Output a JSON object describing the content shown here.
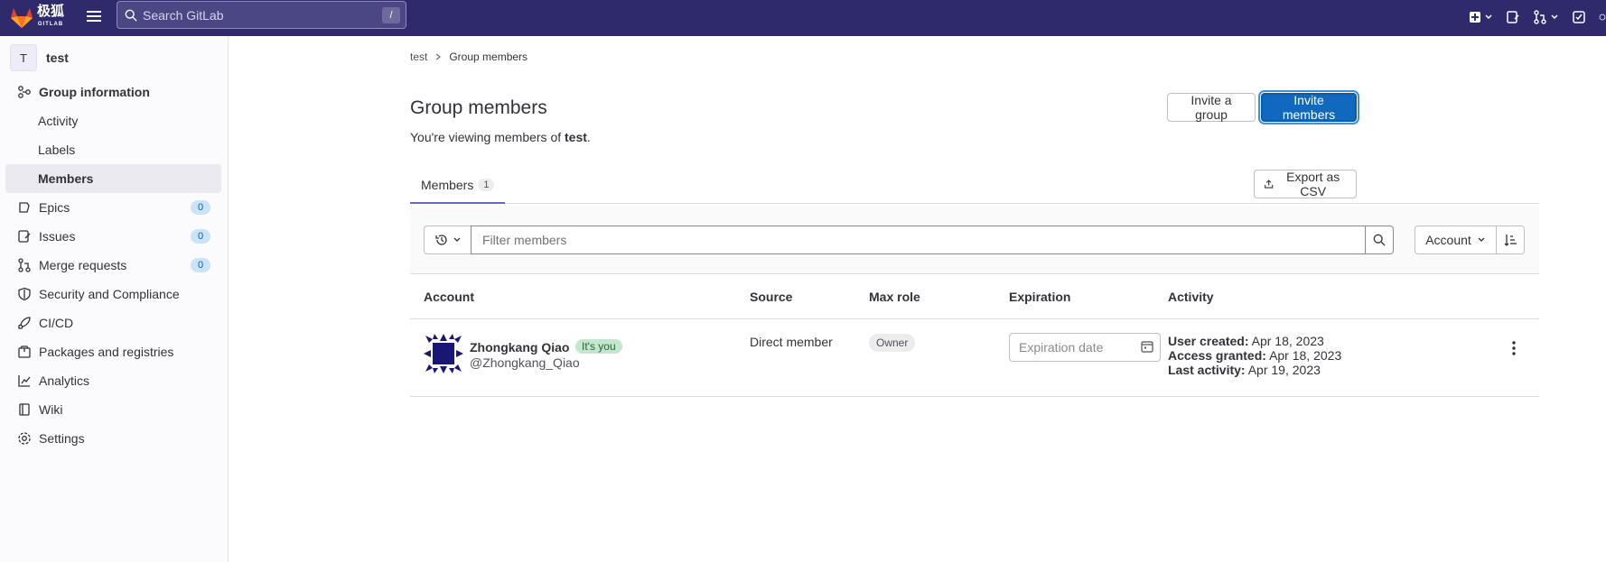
{
  "topbar": {
    "logo_text": "极狐",
    "logo_sub": "GITLAB",
    "search_placeholder": "Search GitLab",
    "search_shortcut": "/"
  },
  "sidebar": {
    "context_initial": "T",
    "context_name": "test",
    "items": [
      {
        "label": "Group information",
        "icon": "group-icon"
      },
      {
        "label": "Activity"
      },
      {
        "label": "Labels"
      },
      {
        "label": "Members"
      },
      {
        "label": "Epics",
        "icon": "epic-icon",
        "count": "0"
      },
      {
        "label": "Issues",
        "icon": "issues-icon",
        "count": "0"
      },
      {
        "label": "Merge requests",
        "icon": "merge-request-icon",
        "count": "0"
      },
      {
        "label": "Security and Compliance",
        "icon": "shield-icon"
      },
      {
        "label": "CI/CD",
        "icon": "rocket-icon"
      },
      {
        "label": "Packages and registries",
        "icon": "package-icon"
      },
      {
        "label": "Analytics",
        "icon": "chart-icon"
      },
      {
        "label": "Wiki",
        "icon": "book-icon"
      },
      {
        "label": "Settings",
        "icon": "gear-icon"
      }
    ]
  },
  "breadcrumb": {
    "root": "test",
    "current": "Group members"
  },
  "page": {
    "title": "Group members",
    "subtitle_prefix": "You're viewing members of ",
    "subtitle_group": "test",
    "subtitle_suffix": ".",
    "invite_group": "Invite a group",
    "invite_members": "Invite members",
    "export_csv": "Export as CSV"
  },
  "tabs": [
    {
      "label": "Members",
      "count": "1"
    }
  ],
  "filter": {
    "placeholder": "Filter members",
    "sort_label": "Account"
  },
  "table": {
    "headers": [
      "Account",
      "Source",
      "Max role",
      "Expiration",
      "Activity"
    ],
    "rows": [
      {
        "name": "Zhongkang Qiao",
        "badge": "It's you",
        "handle": "@Zhongkang_Qiao",
        "source": "Direct member",
        "role": "Owner",
        "expiration_placeholder": "Expiration date",
        "user_created_label": "User created:",
        "user_created": "Apr 18, 2023",
        "access_granted_label": "Access granted:",
        "access_granted": "Apr 18, 2023",
        "last_activity_label": "Last activity:",
        "last_activity": "Apr 19, 2023"
      }
    ]
  },
  "colors": {
    "topbar": "#2f2a6b",
    "primary": "#1068bf",
    "tab_indicator": "#6666c4"
  }
}
